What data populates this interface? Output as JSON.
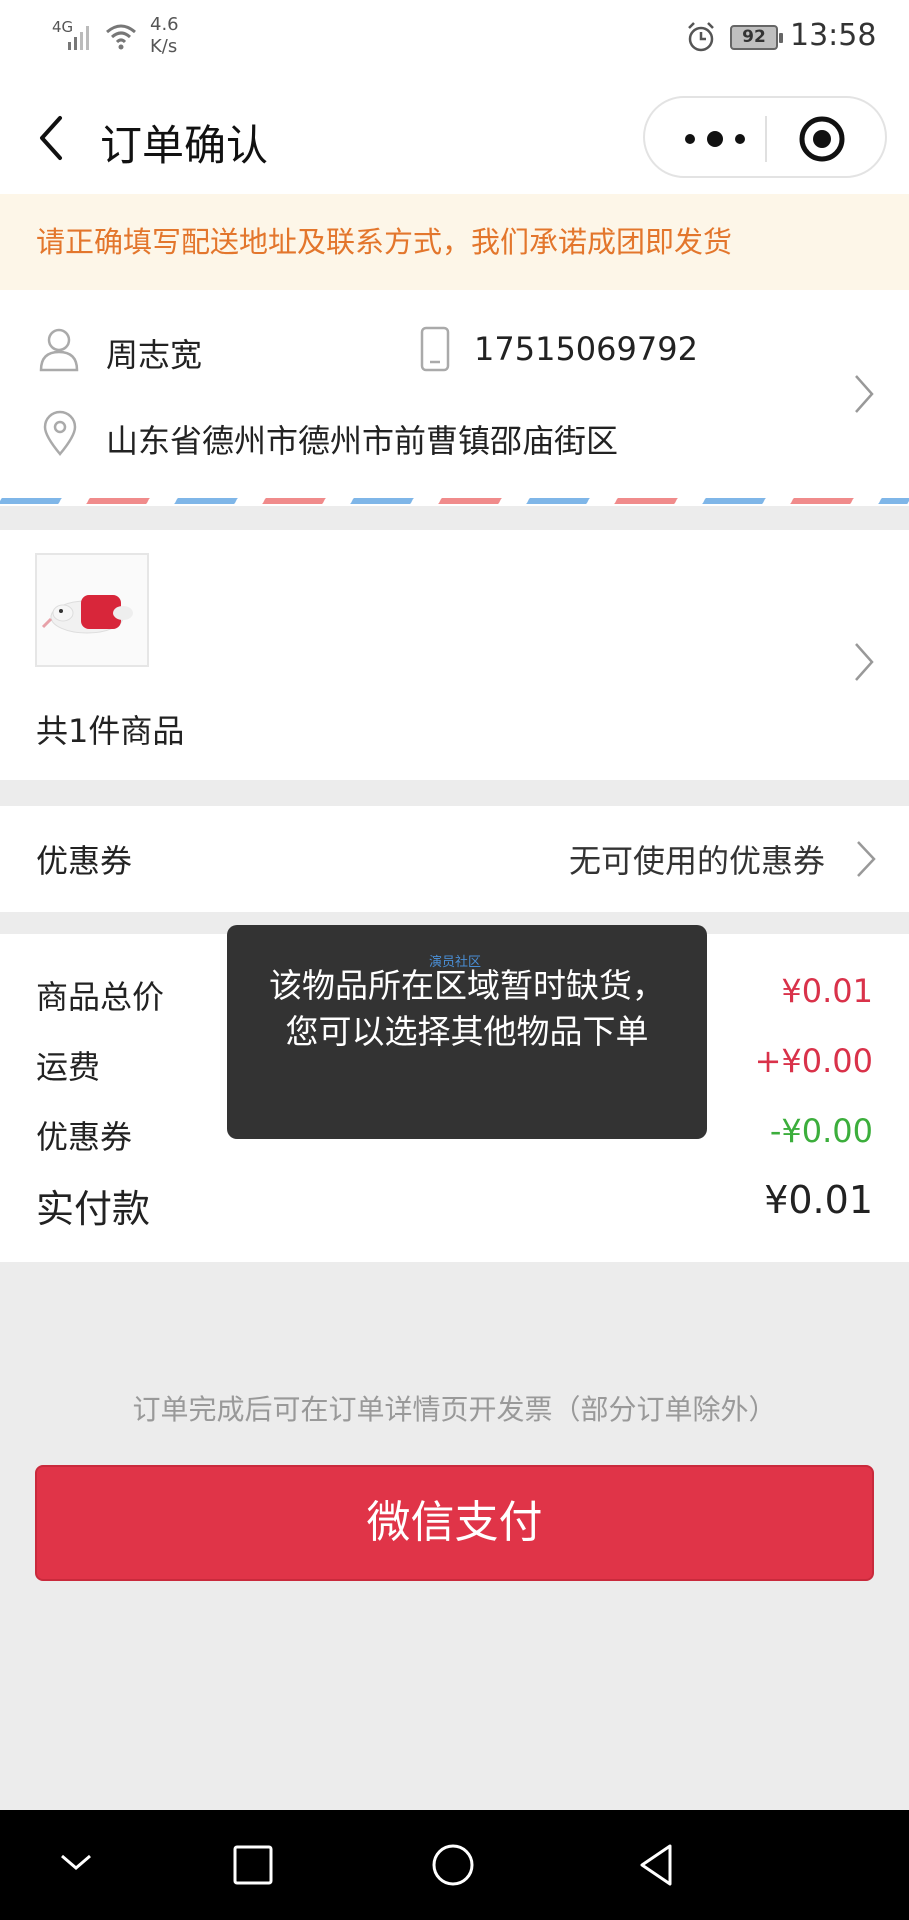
{
  "status_bar": {
    "network": "4G",
    "speed": "4.6\nK/s",
    "battery": "92",
    "time": "13:58"
  },
  "nav": {
    "title": "订单确认"
  },
  "notice": {
    "text": "请正确填写配送地址及联系方式，我们承诺成团即发货"
  },
  "address": {
    "name": "周志宽",
    "phone": "17515069792",
    "address": "山东省德州市德州市前曹镇邵庙街区"
  },
  "product": {
    "count_text": "共1件商品"
  },
  "coupon": {
    "label": "优惠券",
    "value": "无可使用的优惠券"
  },
  "price": {
    "goods_total_label": "商品总价",
    "goods_total_value": "¥0.01",
    "shipping_label": "运费",
    "shipping_value": "+¥0.00",
    "coupon_label": "优惠券",
    "coupon_value": "-¥0.00",
    "paid_label": "实付款",
    "paid_value": "¥0.01"
  },
  "toast": {
    "watermark": "演员社区",
    "text": "该物品所在区域暂时缺货，您可以选择其他物品下单"
  },
  "invoice_tip": "订单完成后可在订单详情页开发票（部分订单除外）",
  "pay_button": "微信支付",
  "colors": {
    "accent_red": "#e03448",
    "price_red": "#d9324a",
    "discount_green": "#3cae3c",
    "notice_orange": "#e3762c",
    "notice_bg": "#fdf6e8"
  },
  "icons": [
    "back-icon",
    "more-icon",
    "target-icon",
    "person-icon",
    "phone-icon",
    "location-pin-icon",
    "chevron-right-icon",
    "nav-back-triangle-icon",
    "nav-home-circle-icon",
    "nav-recent-square-icon",
    "nav-collapse-chevron-icon"
  ]
}
